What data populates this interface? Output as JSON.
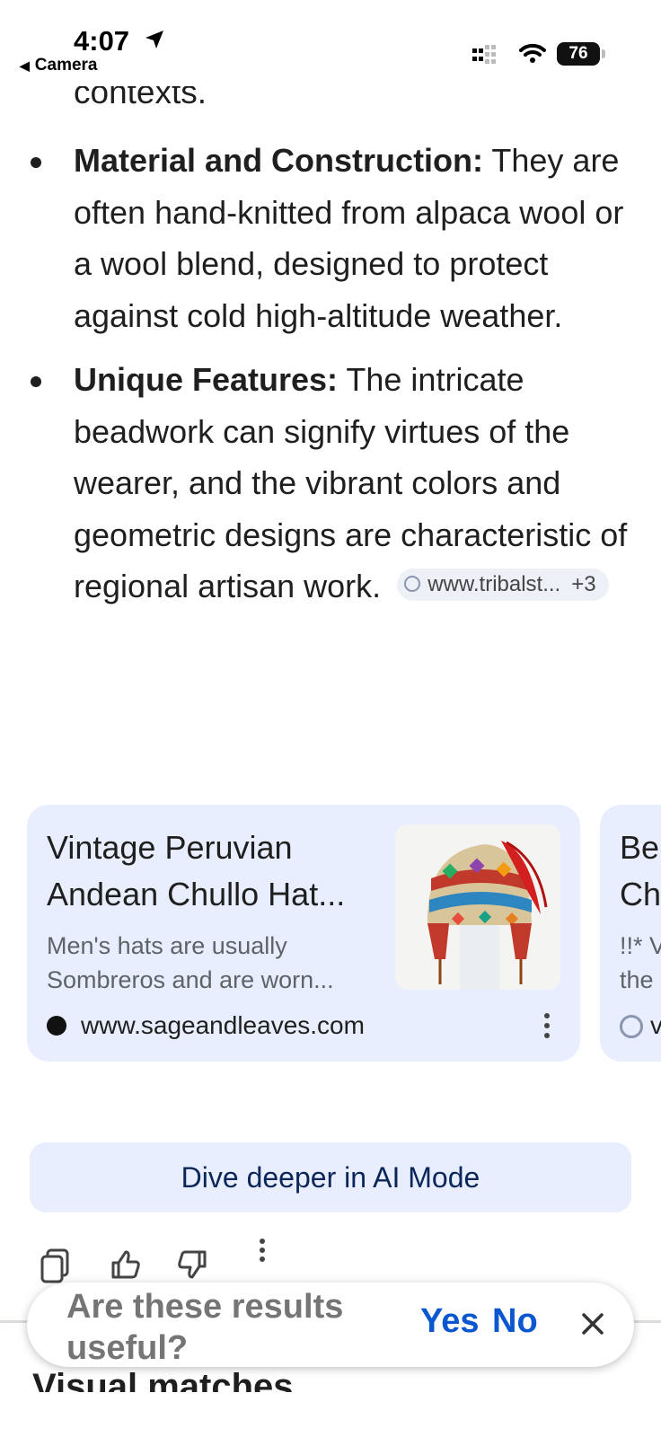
{
  "status_bar": {
    "time": "4:07",
    "back_label": "Camera",
    "battery": "76"
  },
  "content": {
    "clipped_previous_text": "contexts.",
    "bullets": [
      {
        "heading": "Material and Construction:",
        "text": " They are often hand-knitted from alpaca wool or a wool blend, designed to protect against cold high-altitude weather."
      },
      {
        "heading": "Unique Features:",
        "text": " The intricate beadwork can signify virtues of the wearer, and the vibrant colors and geometric designs are characteristic of regional artisan work.",
        "source_chip": {
          "label": "www.tribalst...",
          "count": "+3"
        }
      }
    ]
  },
  "cards": [
    {
      "title": "Vintage Peruvian Andean Chullo Hat...",
      "description": "Men's hats are usually Sombreros and are worn...",
      "source": "www.sageandleaves.com"
    },
    {
      "title_partial": "Be\nCh",
      "description_partial": "!!* V\nthe",
      "source_partial": "v"
    }
  ],
  "ai_mode_button": "Dive deeper in AI Mode",
  "feedback": {
    "question": "Are these results useful?",
    "yes": "Yes",
    "no": "No"
  },
  "next_section_heading": "Visual matches",
  "colors": {
    "card_bg": "#e8eefe",
    "accent_blue": "#0b57d0",
    "ai_button_text": "#0b2658"
  }
}
